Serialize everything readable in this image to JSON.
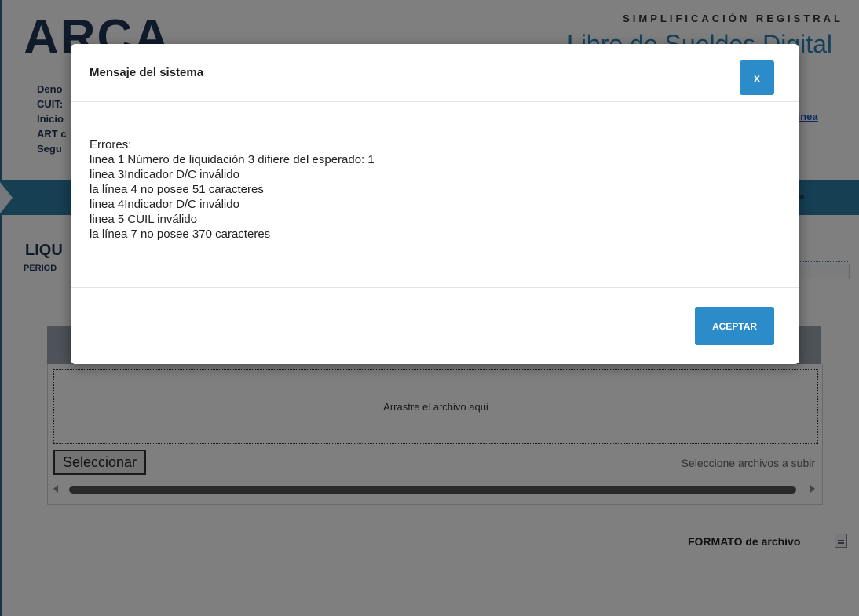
{
  "header": {
    "logo": "ARCA",
    "subtitle": "SIMPLIFICACIÓN REGISTRAL",
    "title": "Libro de Sueldos Digital"
  },
  "company_info": {
    "labels": [
      "Deno",
      "CUIT:",
      "Inicio",
      "ART c",
      "Segu"
    ]
  },
  "help_link": "linea",
  "section": {
    "title": "LIQU",
    "period_label": "PERIOD"
  },
  "upload": {
    "drop_text": "Arrastre el archivo aqui",
    "select_label": "Seleccionar",
    "select_hint": "Seleccione archivos a subir"
  },
  "format_link": "FORMATO de archivo",
  "modal": {
    "title": "Mensaje del sistema",
    "close_label": "x",
    "errors_heading": "Errores:",
    "errors": [
      "linea 1 Número de liquidación 3 difiere del esperado: 1",
      "linea 3Indicador D/C inválido",
      "la línea 4 no posee 51 caracteres",
      "linea 4Indicador D/C inválido",
      "linea 5 CUIL inválido",
      "la línea 7 no posee 370 caracteres"
    ],
    "accept_label": "ACEPTAR"
  },
  "colors": {
    "accent": "#2c8cc9",
    "brand_bar": "#2c7fa8",
    "logo": "#1f3556"
  }
}
